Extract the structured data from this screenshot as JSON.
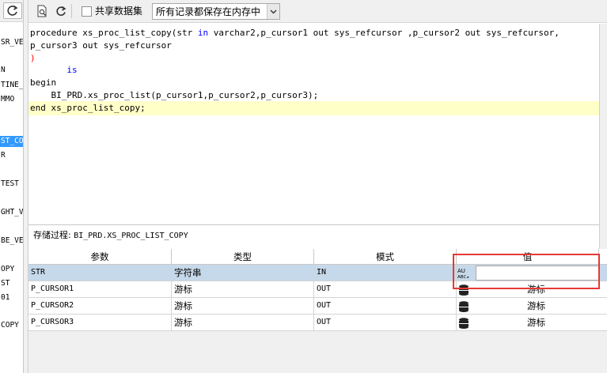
{
  "left_panel": {
    "items": [
      {
        "label": "SR_VE",
        "selected": false
      },
      {
        "label": "N",
        "selected": false
      },
      {
        "label": "TINE_",
        "selected": false
      },
      {
        "label": "MMO",
        "selected": false
      },
      {
        "label": "ST_CO",
        "selected": true
      },
      {
        "label": "R",
        "selected": false
      },
      {
        "label": "TEST",
        "selected": false
      },
      {
        "label": "GHT_V",
        "selected": false
      },
      {
        "label": "BE_VE",
        "selected": false
      },
      {
        "label": "OPY",
        "selected": false
      },
      {
        "label": "ST",
        "selected": false
      },
      {
        "label": "01",
        "selected": false
      },
      {
        "label": "COPY",
        "selected": false
      }
    ]
  },
  "toolbar": {
    "share_dataset_label": "共享数据集",
    "share_dataset_checked": false,
    "records_select_value": "所有记录都保存在内存中"
  },
  "editor": {
    "lines": [
      {
        "text": "procedure xs_proc_list_copy(str in varchar2,p_cursor1 out sys_refcursor ,p_cursor2 out sys_refcursor,"
      },
      {
        "text": "p_cursor3 out sys_refcursor"
      },
      {
        "text": ")"
      },
      {
        "text": "       is"
      },
      {
        "text": "begin"
      },
      {
        "text": "    BI_PRD.xs_proc_list(p_cursor1,p_cursor2,p_cursor3);"
      },
      {
        "text": "end xs_proc_list_copy;"
      }
    ]
  },
  "procedure_label": {
    "prefix": "存储过程:",
    "name": "BI_PRD.XS_PROC_LIST_COPY"
  },
  "params_grid": {
    "headers": [
      "参数",
      "类型",
      "模式",
      "值"
    ],
    "rows": [
      {
        "param": "STR",
        "type": "字符串",
        "mode": "IN",
        "value": "",
        "value_icon": "abc-text-icon",
        "selected": true
      },
      {
        "param": "P_CURSOR1",
        "type": "游标",
        "mode": "OUT",
        "value": "游标",
        "value_icon": "database-icon",
        "selected": false
      },
      {
        "param": "P_CURSOR2",
        "type": "游标",
        "mode": "OUT",
        "value": "游标",
        "value_icon": "database-icon",
        "selected": false
      },
      {
        "param": "P_CURSOR3",
        "type": "游标",
        "mode": "OUT",
        "value": "游标",
        "value_icon": "database-icon",
        "selected": false
      }
    ]
  },
  "colors": {
    "keyword": "#0000ff",
    "paren": "#ff0000",
    "current_line": "#ffffc8",
    "selected_row": "#c6d9ea",
    "highlight_box": "#e53935",
    "selected_nav": "#3399ff"
  }
}
